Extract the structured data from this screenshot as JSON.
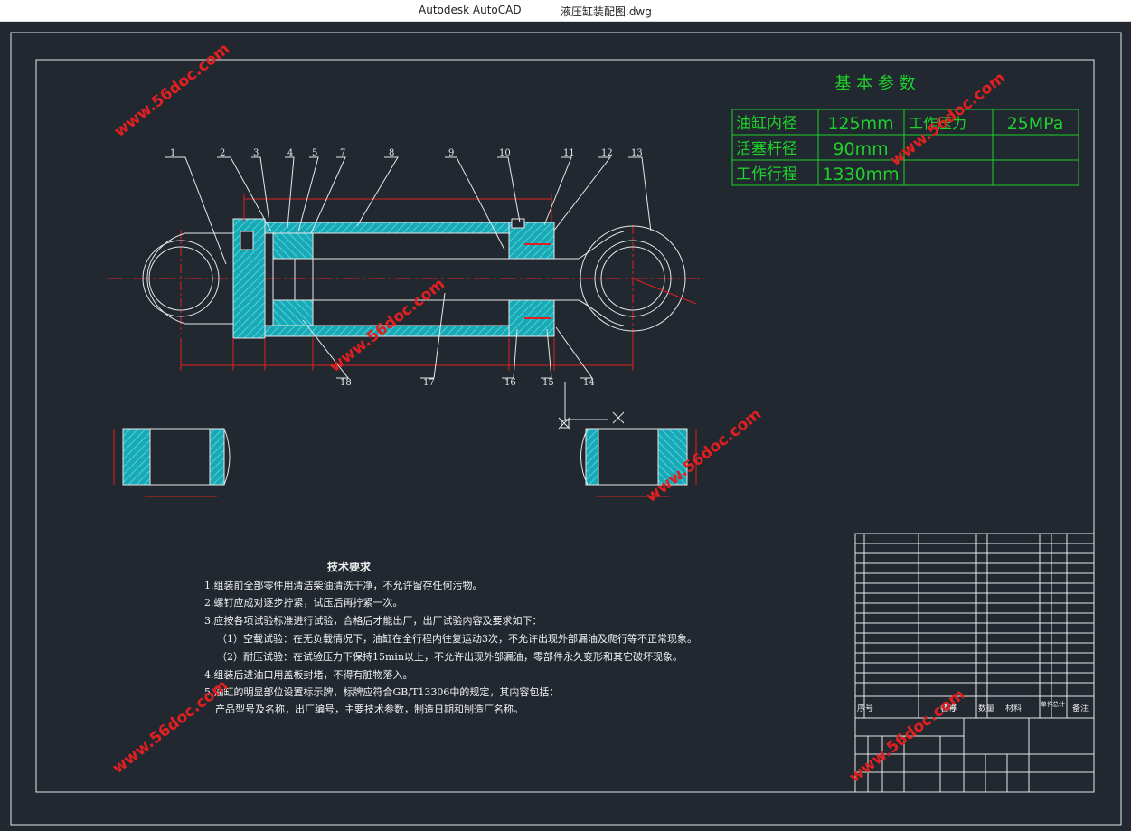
{
  "window": {
    "app_name": "Autodesk AutoCAD",
    "file_name": "液压缸装配图.dwg"
  },
  "params": {
    "title": "基 本 参 数",
    "rows": [
      {
        "label": "油缸内径",
        "value": "125mm"
      },
      {
        "label": "活塞杆径",
        "value": "90mm"
      },
      {
        "label": "工作行程",
        "value": "1330mm"
      }
    ],
    "pressure_label": "工作压力",
    "pressure_value": "25MPa"
  },
  "balloons": [
    "1",
    "2",
    "3",
    "4",
    "5",
    "7",
    "8",
    "9",
    "10",
    "11",
    "12",
    "13"
  ],
  "balloons_bottom": [
    "18",
    "17",
    "16",
    "15",
    "14"
  ],
  "tech": {
    "heading": "技术要求",
    "lines": [
      "1.组装前全部零件用清洁柴油清洗干净，不允许留存任何污物。",
      "2.螺钉应成对逐步拧紧，试压后再拧紧一次。",
      "3.应按各项试验标准进行试验，合格后才能出厂，出厂试验内容及要求如下：",
      "（1）空载试验：在无负载情况下，油缸在全行程内往复运动3次，不允许出现外部漏油及爬行等不正常现象。",
      "（2）耐压试验：在试验压力下保持15min以上，不允许出现外部漏油，零部件永久变形和其它破坏现象。",
      "4.组装后进油口用盖板封堵，不得有脏物落入。",
      "5.油缸的明显部位设置标示牌，标牌应符合GB/T13306中的规定，其内容包括：",
      "产品型号及名称，出厂编号，主要技术参数，制造日期和制造厂名称。"
    ]
  },
  "bom": {
    "header": [
      "序号",
      "代号",
      "名称",
      "数量",
      "材料",
      "单件",
      "总计",
      "备注"
    ]
  },
  "watermark": "www.56doc.com",
  "colors": {
    "canvas": "#212830",
    "cyan": "#22b8c4",
    "green": "#1fd12a",
    "white": "#e8e8e8",
    "red": "#e02020"
  }
}
